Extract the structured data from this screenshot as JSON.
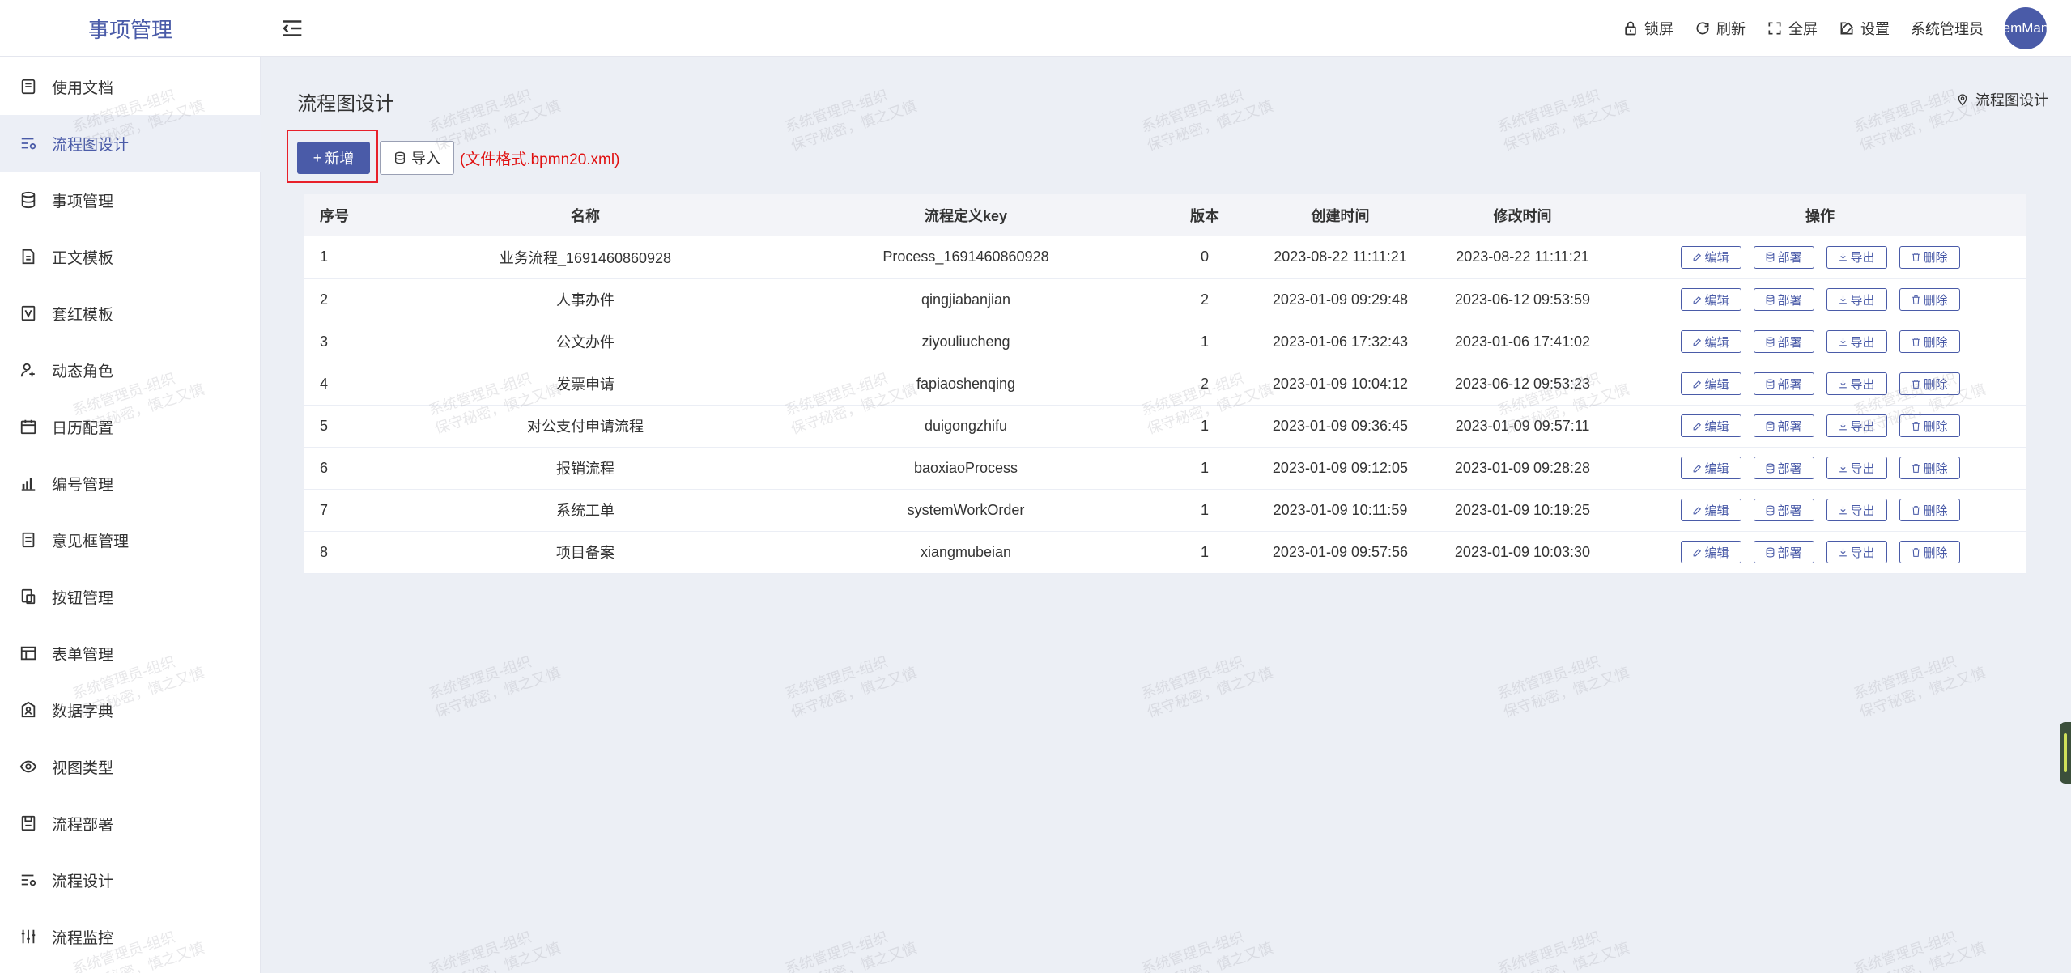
{
  "app": {
    "title": "事项管理"
  },
  "header": {
    "lock": "锁屏",
    "refresh": "刷新",
    "fullscreen": "全屏",
    "settings": "设置",
    "user": "系统管理员",
    "avatar_text": "emMan"
  },
  "sidebar": {
    "items": [
      {
        "label": "使用文档",
        "icon": "doc-icon"
      },
      {
        "label": "流程图设计",
        "icon": "flow-design-icon"
      },
      {
        "label": "事项管理",
        "icon": "database-icon"
      },
      {
        "label": "正文模板",
        "icon": "template-icon"
      },
      {
        "label": "套红模板",
        "icon": "red-template-icon"
      },
      {
        "label": "动态角色",
        "icon": "user-add-icon"
      },
      {
        "label": "日历配置",
        "icon": "calendar-icon"
      },
      {
        "label": "编号管理",
        "icon": "bar-chart-icon"
      },
      {
        "label": "意见框管理",
        "icon": "comment-box-icon"
      },
      {
        "label": "按钮管理",
        "icon": "button-icon"
      },
      {
        "label": "表单管理",
        "icon": "table-icon"
      },
      {
        "label": "数据字典",
        "icon": "dictionary-icon"
      },
      {
        "label": "视图类型",
        "icon": "eye-icon"
      },
      {
        "label": "流程部署",
        "icon": "deploy-icon"
      },
      {
        "label": "流程设计",
        "icon": "flow-icon"
      },
      {
        "label": "流程监控",
        "icon": "monitor-icon"
      }
    ]
  },
  "main": {
    "title": "流程图设计",
    "breadcrumb": "流程图设计",
    "add_button": "新增",
    "import_button": "导入",
    "import_hint": "(文件格式.bpmn20.xml)"
  },
  "table": {
    "columns": [
      "序号",
      "名称",
      "流程定义key",
      "版本",
      "创建时间",
      "修改时间",
      "操作"
    ],
    "actions": [
      "编辑",
      "部署",
      "导出",
      "删除"
    ],
    "rows": [
      {
        "no": "1",
        "name": "业务流程_1691460860928",
        "key": "Process_1691460860928",
        "version": "0",
        "created": "2023-08-22 11:11:21",
        "modified": "2023-08-22 11:11:21"
      },
      {
        "no": "2",
        "name": "人事办件",
        "key": "qingjiabanjian",
        "version": "2",
        "created": "2023-01-09 09:29:48",
        "modified": "2023-06-12 09:53:59"
      },
      {
        "no": "3",
        "name": "公文办件",
        "key": "ziyouliucheng",
        "version": "1",
        "created": "2023-01-06 17:32:43",
        "modified": "2023-01-06 17:41:02"
      },
      {
        "no": "4",
        "name": "发票申请",
        "key": "fapiaoshenqing",
        "version": "2",
        "created": "2023-01-09 10:04:12",
        "modified": "2023-06-12 09:53:23"
      },
      {
        "no": "5",
        "name": "对公支付申请流程",
        "key": "duigongzhifu",
        "version": "1",
        "created": "2023-01-09 09:36:45",
        "modified": "2023-01-09 09:57:11"
      },
      {
        "no": "6",
        "name": "报销流程",
        "key": "baoxiaoProcess",
        "version": "1",
        "created": "2023-01-09 09:12:05",
        "modified": "2023-01-09 09:28:28"
      },
      {
        "no": "7",
        "name": "系统工单",
        "key": "systemWorkOrder",
        "version": "1",
        "created": "2023-01-09 10:11:59",
        "modified": "2023-01-09 10:19:25"
      },
      {
        "no": "8",
        "name": "项目备案",
        "key": "xiangmubeian",
        "version": "1",
        "created": "2023-01-09 09:57:56",
        "modified": "2023-01-09 10:03:30"
      }
    ]
  },
  "watermark": {
    "line1": "系统管理员-组织",
    "line2": "保守秘密，慎之又慎"
  },
  "colors": {
    "accent": "#4a5ba8",
    "highlight_box": "#e8202a",
    "hint": "#e01010"
  }
}
